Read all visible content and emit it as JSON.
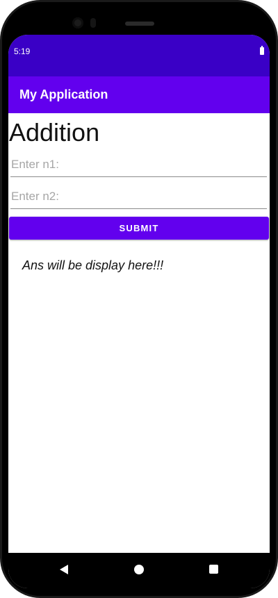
{
  "status_bar": {
    "time": "5:19",
    "battery_icon": "battery-full-icon",
    "color": "#3a00c6"
  },
  "app_bar": {
    "title": "My Application",
    "color": "#6200ee"
  },
  "main": {
    "heading": "Addition",
    "n1_placeholder": "Enter n1:",
    "n1_value": "",
    "n2_placeholder": "Enter n2:",
    "n2_value": "",
    "submit_label": "SUBMIT",
    "answer_text": "Ans will be display here!!!"
  },
  "nav_bar": {
    "back_icon": "back-triangle-icon",
    "home_icon": "home-circle-icon",
    "recents_icon": "recents-square-icon"
  }
}
